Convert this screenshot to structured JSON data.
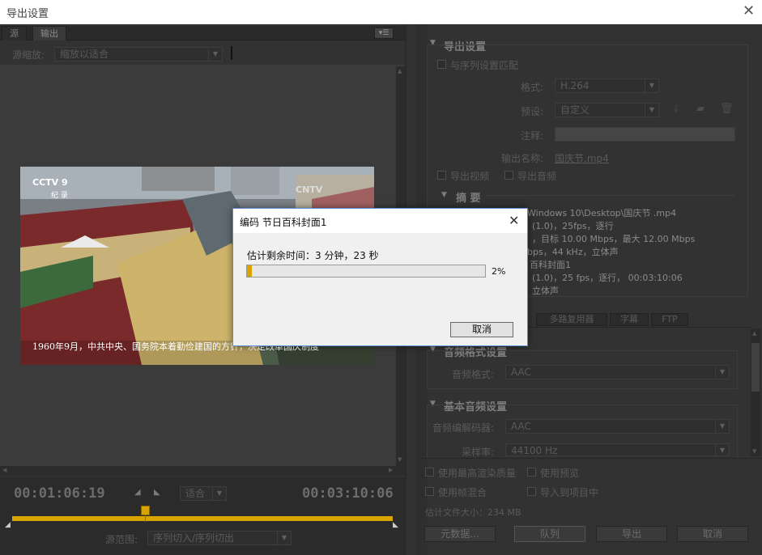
{
  "window": {
    "title": "导出设置",
    "close": "✕"
  },
  "left": {
    "tabs": [
      "源",
      "输出"
    ],
    "source_scale_label": "源缩放:",
    "source_scale_value": "缩放以适合",
    "overlay_logo": "CCTV 9",
    "overlay_logo_sub": "纪 录",
    "overlay_logo_right": "CNTV",
    "subtitle": "1960年9月，中共中央、国务院本着勤俭建国的方针，决定改革国庆制度",
    "timecode_current": "00:01:06:19",
    "timecode_end": "00:03:10:06",
    "fit_value": "适合",
    "range_label": "源范围:",
    "range_value": "序列切入/序列切出"
  },
  "right": {
    "export_settings_title": "导出设置",
    "match_sequence": "与序列设置匹配",
    "format_label": "格式:",
    "format_value": "H.264",
    "preset_label": "预设:",
    "preset_value": "自定义",
    "comment_label": "注释:",
    "output_name_label": "输出名称:",
    "output_name_value": "国庆节.mp4",
    "export_video": "导出视频",
    "export_audio": "导出音频",
    "summary_title": "摘 要",
    "summary_lines": [
      "Windows 10\\Desktop\\国庆节 .mp4",
      "(1.0)，25fps，逐行",
      "，目标 10.00 Mbps，最大 12.00 Mbps",
      "bps，44 kHz，立体声",
      "百科封面1",
      "(1.0)，25 fps，逐行，  00:03:10:06",
      "立体声"
    ],
    "sub_tabs": [
      "多路复用器",
      "字幕",
      "FTP"
    ],
    "audio_format_title": "音频格式设置",
    "audio_format_label": "音频格式:",
    "audio_format_value": "AAC",
    "basic_audio_title": "基本音频设置",
    "audio_codec_label": "音频编解码器:",
    "audio_codec_value": "AAC",
    "sample_rate_label": "采样率:",
    "sample_rate_value": "44100 Hz",
    "max_render_quality": "使用最高渲染质量",
    "use_preview": "使用预览",
    "frame_blending": "使用帧混合",
    "import_project": "导入到项目中",
    "est_file_size": "估计文件大小：234 MB",
    "metadata_btn": "元数据...",
    "queue_btn": "队列",
    "export_btn": "导出",
    "cancel_btn": "取消"
  },
  "dialog": {
    "title": "编码 节日百科封面1",
    "time_remaining": "估计剩余时间：3 分钟，23 秒",
    "percent_text": "2%",
    "progress": 0.02,
    "cancel": "取消"
  }
}
